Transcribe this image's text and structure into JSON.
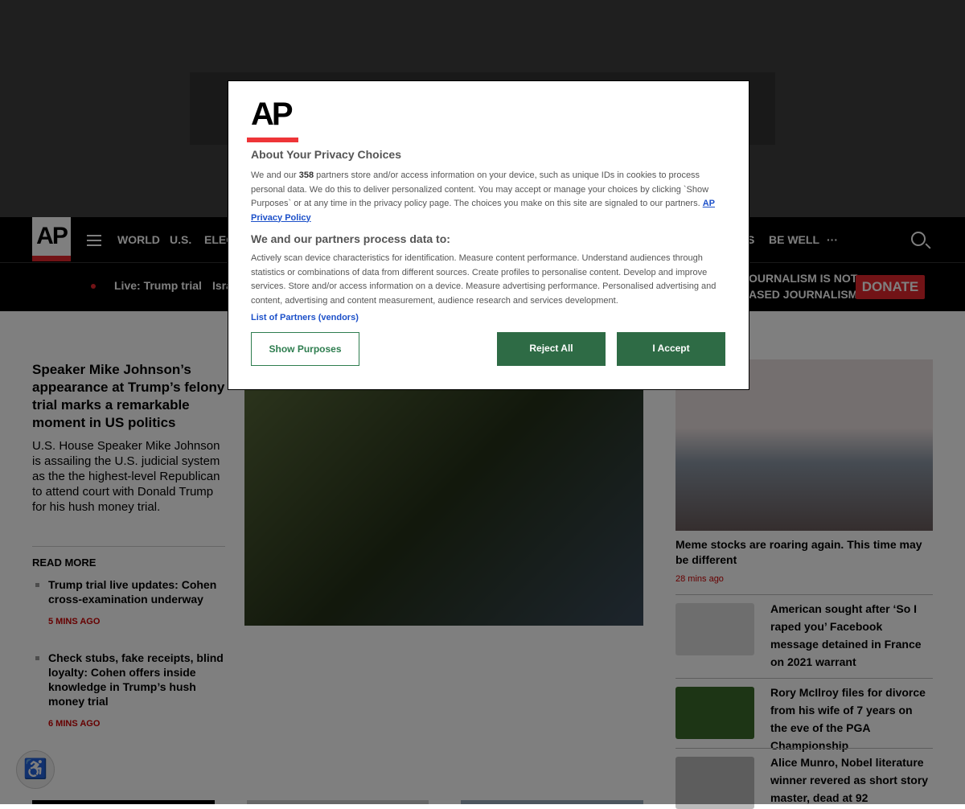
{
  "nav": {
    "logo": "AP",
    "items": [
      "WORLD",
      "U.S.",
      "ELEC",
      "S",
      "BE WELL",
      "···"
    ]
  },
  "subnav": {
    "live": "Live: Trump trial",
    "item2": "Isra",
    "tagline1": "OURNALISM IS NOT.",
    "tagline2": "ASED JOURNALISM.",
    "donate": "DONATE"
  },
  "lead": {
    "headline": "Speaker Mike Johnson’s appearance at Trump’s felony trial marks a remarkable moment in US politics",
    "lede": "U.S. House Speaker Mike Johnson is assailing the U.S. judicial system as the the highest-level Republican to attend court with Donald Trump for his hush money trial.",
    "read_more": "READ MORE",
    "related": [
      {
        "title": "Trump trial live updates: Cohen cross-examination underway",
        "time": "5 MINS AGO"
      },
      {
        "title": "Check stubs, fake receipts, blind loyalty: Cohen offers inside knowledge in Trump’s hush money trial",
        "time": "6 MINS AGO"
      }
    ]
  },
  "right": {
    "top": {
      "title": "Meme stocks are roaring again. This time may be different",
      "time": "28 mins ago"
    },
    "stories": [
      "American sought after ‘So I raped you’ Facebook message detained in France on 2021 warrant",
      "Rory McIlroy files for divorce from his wife of 7 years on the eve of the PGA Championship",
      "Alice Munro, Nobel literature winner revered as short story master, dead at 92"
    ]
  },
  "modal": {
    "logo": "AP",
    "title": "About Your Privacy Choices",
    "p1_a": "We and our ",
    "partners_count": "358",
    "p1_b": " partners store and/or access information on your device, such as unique IDs in cookies to process personal data. We do this to deliver personalized content. You may accept or manage your choices by clicking `Show Purposes` or at any time in the privacy policy page. The choices you make on this site are signaled to our partners.  ",
    "privacy_link": "AP Privacy Policy",
    "subtitle": "We and our partners process data to:",
    "p2": "Actively scan device characteristics for identification. Measure content performance. Understand audiences through statistics or combinations of data from different sources. Create profiles to personalise content. Develop and improve services. Store and/or access information on a device. Measure advertising performance. Personalised advertising and content, advertising and content measurement, audience research and services development.",
    "partners_link": "List of Partners (vendors)",
    "show_purposes": "Show Purposes",
    "reject": "Reject All",
    "accept": "I Accept"
  },
  "colors": {
    "accent": "#e4262c",
    "button_green": "#2e7d4f",
    "link": "#1c50c9"
  }
}
